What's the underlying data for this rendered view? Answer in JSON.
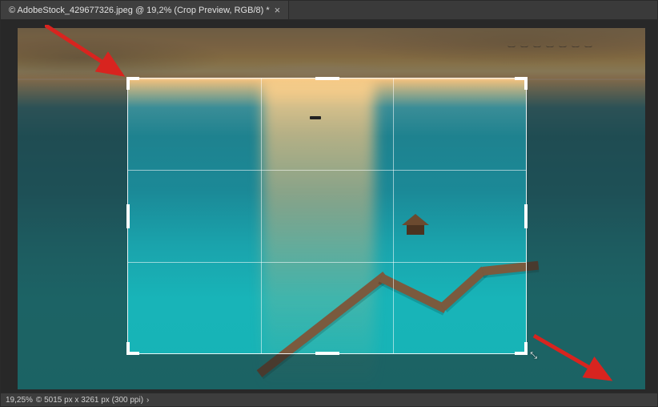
{
  "tab": {
    "title": "© AdobeStock_429677326.jpeg @ 19,2% (Crop Preview, RGB/8) *",
    "close_glyph": "×"
  },
  "statusbar": {
    "zoom": "19,25%",
    "dimensions": "© 5015 px x 3261 px (300 ppi)",
    "chevron": "›"
  },
  "crop": {
    "cursor_icon_name": "resize-diagonal-cursor"
  },
  "annotations": {
    "arrow_color": "#d8241f"
  },
  "icons": {
    "resize_glyph": "⤡"
  }
}
